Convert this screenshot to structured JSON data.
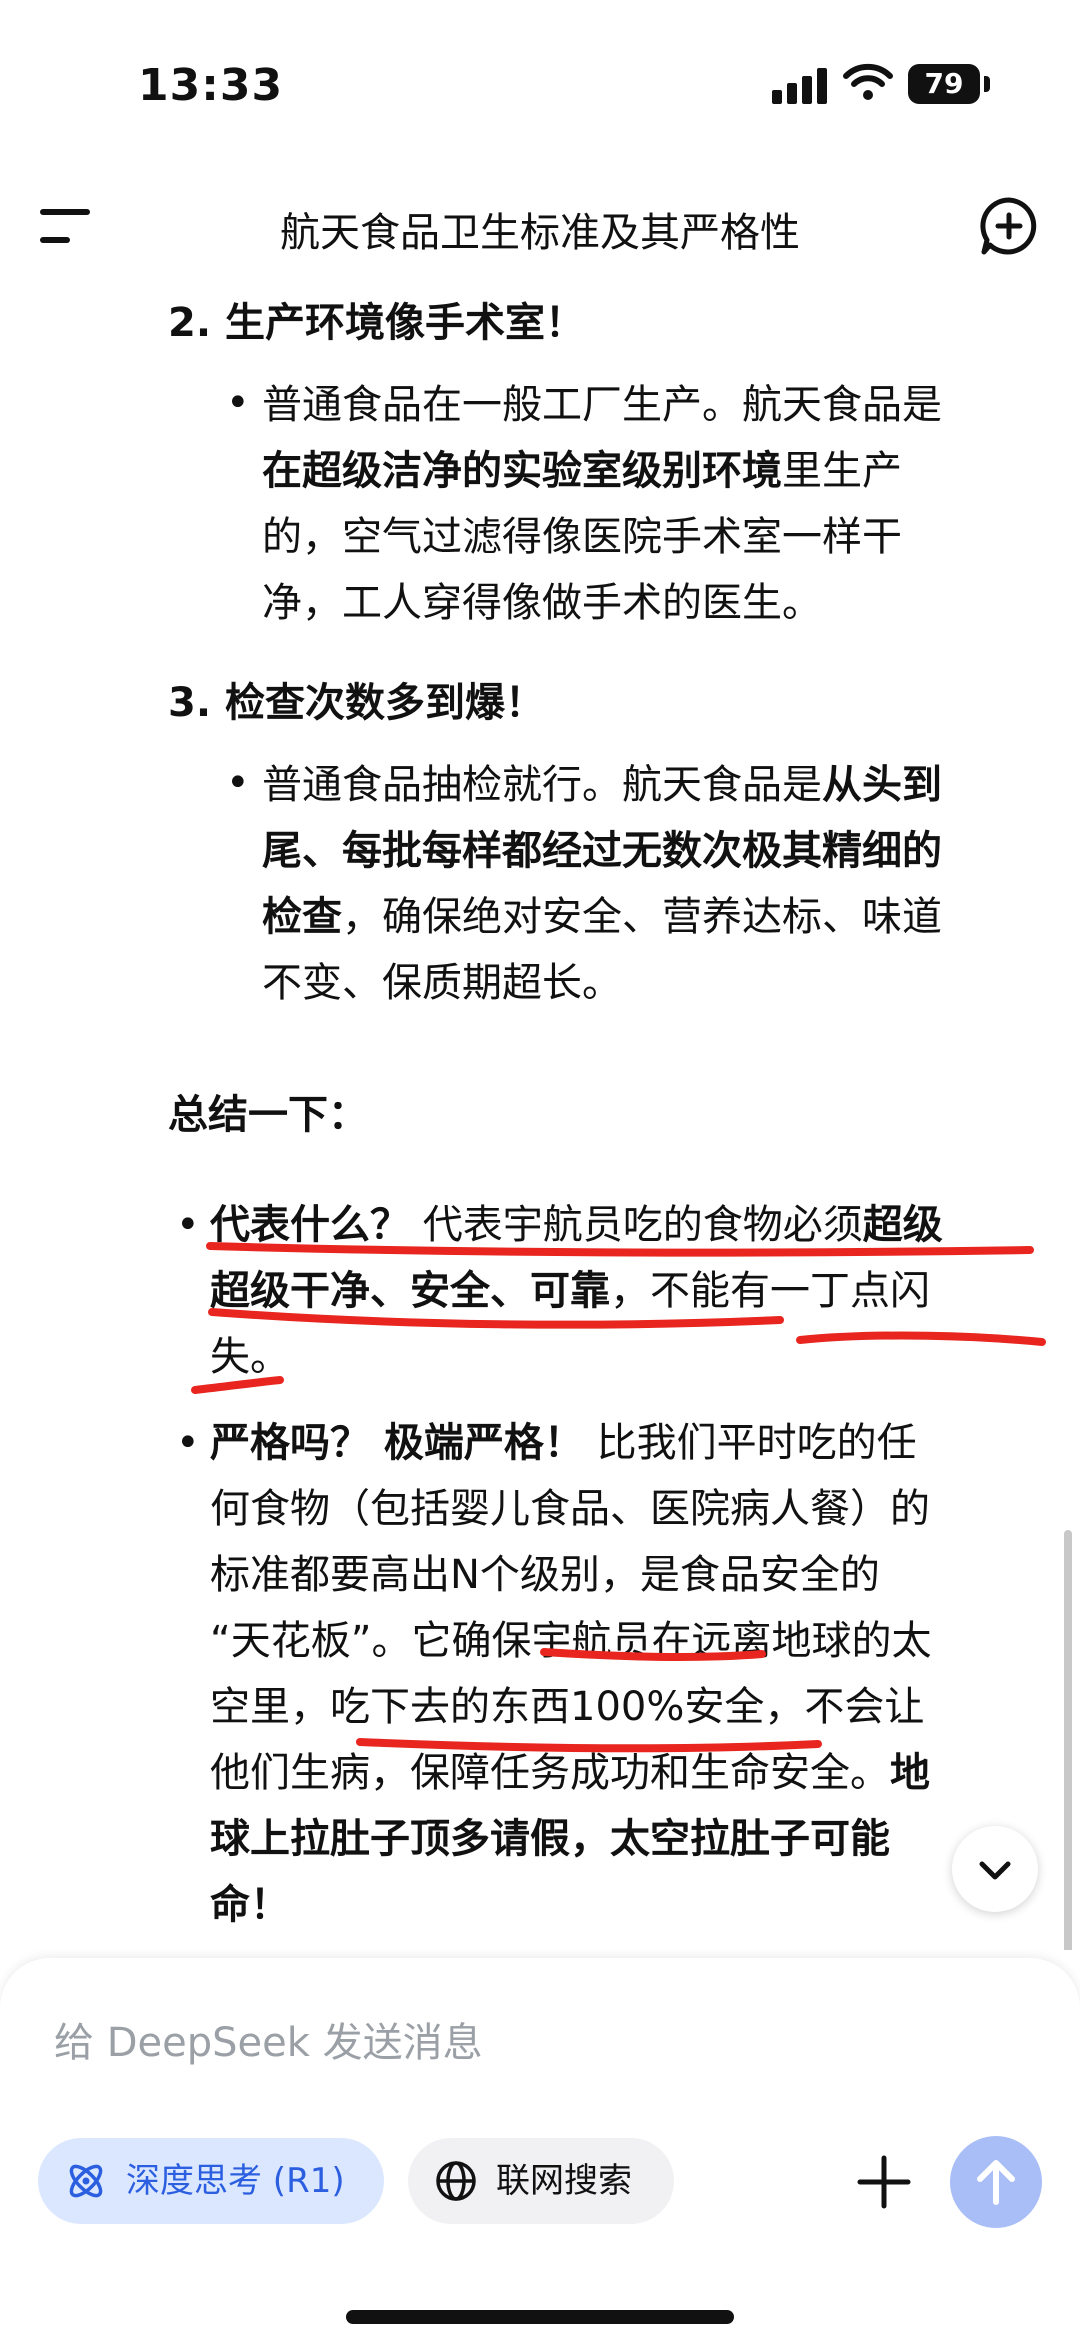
{
  "status_bar": {
    "time": "13:33",
    "battery": "79"
  },
  "header": {
    "title": "航天食品卫生标准及其严格性"
  },
  "content": {
    "section2": {
      "heading": "2. 生产环境像手术室！",
      "lines": [
        [
          "普通食品在一般工厂生产。航天食品是"
        ],
        [
          {
            "b": "在超级洁净的实验室级别环境"
          },
          "里生产"
        ],
        [
          "的，空气过滤得像医院手术室一样干"
        ],
        [
          "净，工人穿得像做手术的医生。"
        ]
      ]
    },
    "section3": {
      "heading": "3. 检查次数多到爆！",
      "lines": [
        [
          "普通食品抽检就行。航天食品是",
          {
            "b": "从头到"
          }
        ],
        [
          {
            "b": "尾、每批每样都经过无数次极其精细的"
          }
        ],
        [
          {
            "b": "检查"
          },
          "，确保绝对安全、营养达标、味道"
        ],
        [
          "不变、保质期超长。"
        ]
      ]
    },
    "summary_title": "总结一下：",
    "bullet1": {
      "lines": [
        [
          {
            "b": "代表什么？"
          },
          " 代表宇航员吃的食物必须",
          {
            "b": "超级"
          }
        ],
        [
          {
            "b": "超级干净、安全、可靠"
          },
          "，不能有一丁点闪"
        ],
        [
          "失。"
        ]
      ]
    },
    "bullet2": {
      "lines": [
        [
          {
            "b": "严格吗？ 极端严格！"
          },
          " 比我们平时吃的任"
        ],
        [
          "何食物（包括婴儿食品、医院病人餐）的"
        ],
        [
          "标准都要高出N个级别，是食品安全的"
        ],
        [
          "“天花板”。它确保宇航员在远离地球的太"
        ],
        [
          "空里，吃下去的东西100%安全，不会让"
        ],
        [
          "他们生病，保障任务成功和生命安全。",
          {
            "b": "地"
          }
        ],
        [
          {
            "b": "球上拉肚子顶多请假，太空拉肚子可能"
          }
        ],
        [
          {
            "b": "命！"
          }
        ]
      ]
    }
  },
  "composer": {
    "placeholder": "给 DeepSeek 发送消息",
    "deep_think_label": "深度思考 (R1)",
    "web_search_label": "联网搜索"
  },
  "colors": {
    "accent": "#2c5fe0",
    "annotation": "#e8261f",
    "send_button": "#a9bdf7"
  }
}
